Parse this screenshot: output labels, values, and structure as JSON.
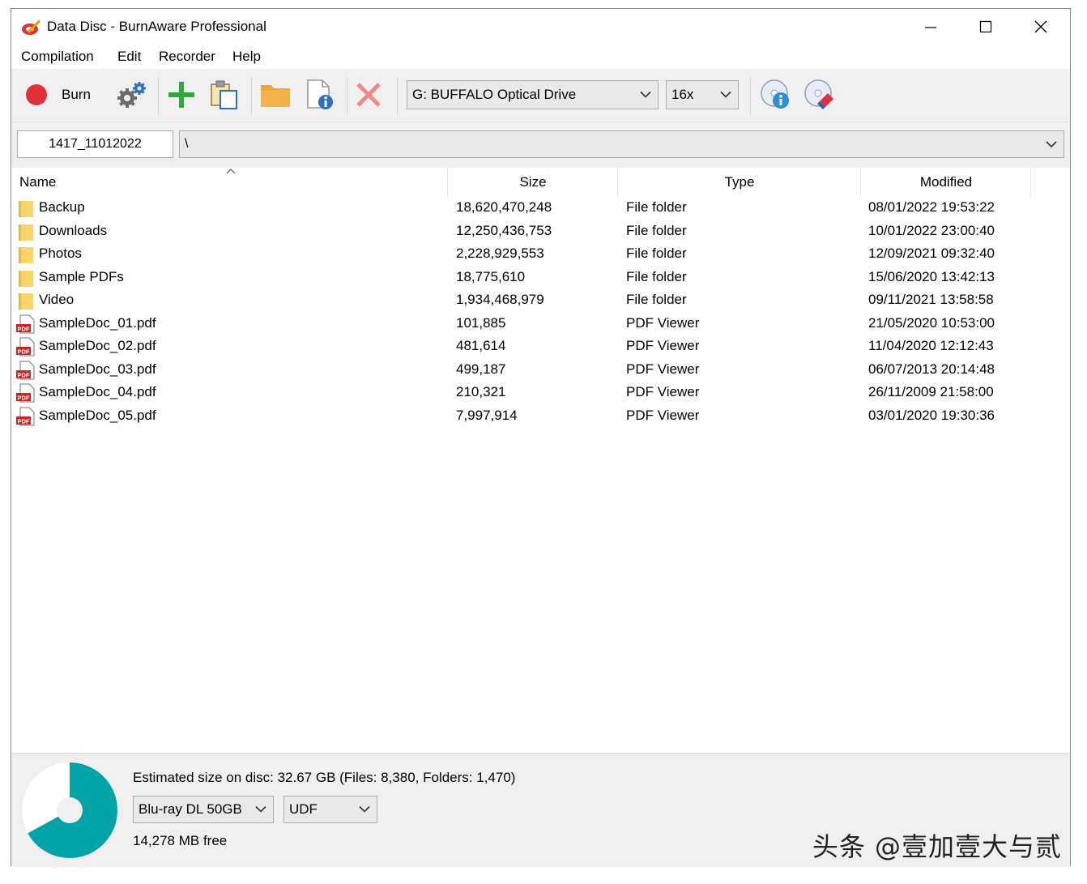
{
  "window": {
    "title": "Data Disc - BurnAware Professional"
  },
  "menu": [
    "Compilation",
    "Edit",
    "Recorder",
    "Help"
  ],
  "toolbar": {
    "burn_label": "Burn",
    "drive": "G: BUFFALO Optical Drive",
    "speed": "16x"
  },
  "pathbar": {
    "disc_label": "1417_11012022",
    "path": "\\"
  },
  "columns": {
    "name": "Name",
    "size": "Size",
    "type": "Type",
    "modified": "Modified"
  },
  "rows": [
    {
      "name": "Backup",
      "size": "18,620,470,248",
      "type": "File folder",
      "modified": "08/01/2022 19:53:22",
      "icon": "folder-icon"
    },
    {
      "name": "Downloads",
      "size": "12,250,436,753",
      "type": "File folder",
      "modified": "10/01/2022 23:00:40",
      "icon": "folder-icon"
    },
    {
      "name": "Photos",
      "size": "2,228,929,553",
      "type": "File folder",
      "modified": "12/09/2021 09:32:40",
      "icon": "folder-icon"
    },
    {
      "name": "Sample PDFs",
      "size": "18,775,610",
      "type": "File folder",
      "modified": "15/06/2020 13:42:13",
      "icon": "folder-icon"
    },
    {
      "name": "Video",
      "size": "1,934,468,979",
      "type": "File folder",
      "modified": "09/11/2021 13:58:58",
      "icon": "folder-icon"
    },
    {
      "name": "SampleDoc_01.pdf",
      "size": "101,885",
      "type": "PDF Viewer",
      "modified": "21/05/2020 10:53:00",
      "icon": "pdf-file-icon"
    },
    {
      "name": "SampleDoc_02.pdf",
      "size": "481,614",
      "type": "PDF Viewer",
      "modified": "11/04/2020 12:12:43",
      "icon": "pdf-file-icon"
    },
    {
      "name": "SampleDoc_03.pdf",
      "size": "499,187",
      "type": "PDF Viewer",
      "modified": "06/07/2013 20:14:48",
      "icon": "pdf-file-icon"
    },
    {
      "name": "SampleDoc_04.pdf",
      "size": "210,321",
      "type": "PDF Viewer",
      "modified": "26/11/2009 21:58:00",
      "icon": "pdf-file-icon"
    },
    {
      "name": "SampleDoc_05.pdf",
      "size": "7,997,914",
      "type": "PDF Viewer",
      "modified": "03/01/2020 19:30:36",
      "icon": "pdf-file-icon"
    }
  ],
  "status": {
    "estimate": "Estimated size on disc: 32.67 GB (Files: 8,380, Folders: 1,470)",
    "disc_type": "Blu-ray DL 50GB",
    "file_system": "UDF",
    "free": "14,278 MB free",
    "used_fraction": 0.67
  },
  "watermark": "头条 @壹加壹大与贰",
  "colors": {
    "accent": "#00a3a6",
    "burn_red": "#e0313a",
    "folder": "#f9d66a",
    "pdf_red": "#c62828"
  }
}
